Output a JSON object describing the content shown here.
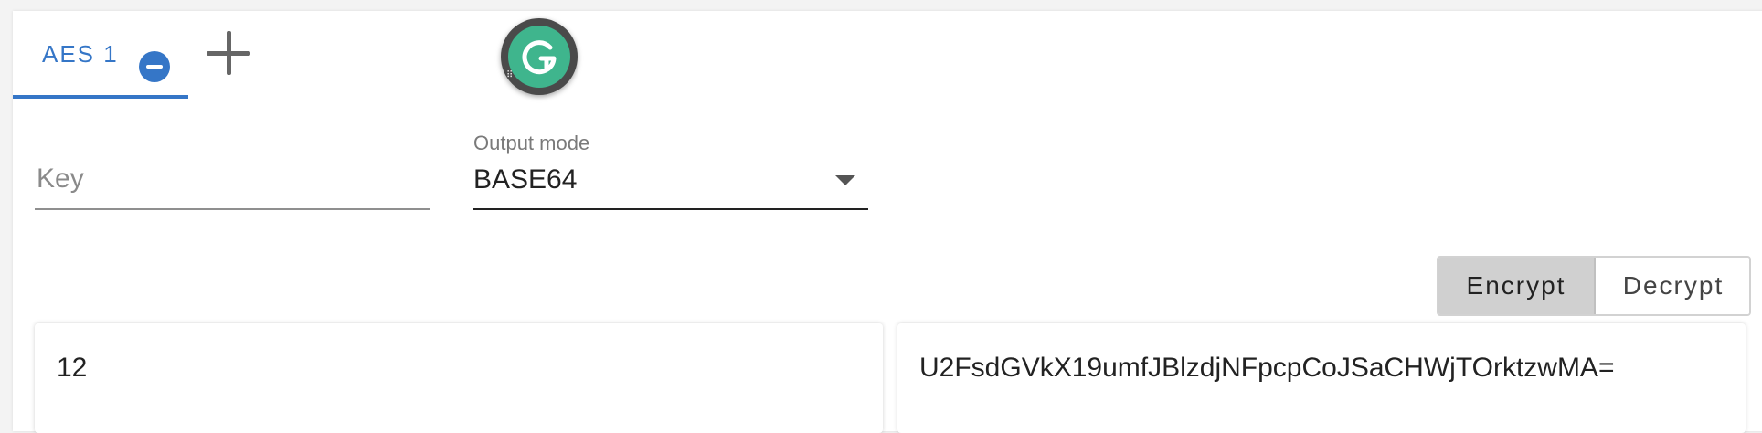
{
  "tabs": {
    "items": [
      {
        "label": "AES 1"
      }
    ],
    "add_icon": "plus-icon",
    "close_icon": "minus-circle-icon",
    "active_color": "#3576c7"
  },
  "floating_badge": {
    "icon": "grammarly-g-icon",
    "color": "#3fb58d"
  },
  "key": {
    "placeholder": "Key",
    "value": ""
  },
  "output_mode": {
    "label": "Output mode",
    "value": "BASE64"
  },
  "mode_toggle": {
    "encrypt_label": "Encrypt",
    "decrypt_label": "Decrypt",
    "selected": "Encrypt"
  },
  "input": {
    "value": "12"
  },
  "output": {
    "value": "U2FsdGVkX19umfJBlzdjNFpcpCoJSaCHWjTOrktzwMA="
  }
}
